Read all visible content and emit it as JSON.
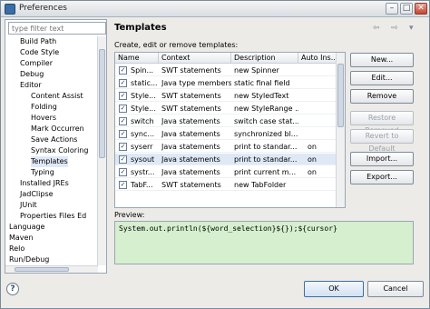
{
  "window": {
    "title": "Preferences"
  },
  "filter": {
    "placeholder": "type filter text"
  },
  "tree": {
    "items": [
      {
        "label": "Build Path",
        "indent": 1
      },
      {
        "label": "Code Style",
        "indent": 1
      },
      {
        "label": "Compiler",
        "indent": 1
      },
      {
        "label": "Debug",
        "indent": 1
      },
      {
        "label": "Editor",
        "indent": 1
      },
      {
        "label": "Content Assist",
        "indent": 2
      },
      {
        "label": "Folding",
        "indent": 2
      },
      {
        "label": "Hovers",
        "indent": 2
      },
      {
        "label": "Mark Occurren",
        "indent": 2
      },
      {
        "label": "Save Actions",
        "indent": 2
      },
      {
        "label": "Syntax Coloring",
        "indent": 2
      },
      {
        "label": "Templates",
        "indent": 2
      },
      {
        "label": "Typing",
        "indent": 2
      },
      {
        "label": "Installed JREs",
        "indent": 1
      },
      {
        "label": "JadClipse",
        "indent": 1
      },
      {
        "label": "JUnit",
        "indent": 1
      },
      {
        "label": "Properties Files Ed",
        "indent": 1
      },
      {
        "label": "Language",
        "indent": 0
      },
      {
        "label": "Maven",
        "indent": 0
      },
      {
        "label": "Relo",
        "indent": 0
      },
      {
        "label": "Run/Debug",
        "indent": 0
      }
    ]
  },
  "page": {
    "title": "Templates",
    "description": "Create, edit or remove templates:",
    "back_arrow": "⇦",
    "forward_arrow": "⇨",
    "menu_arrow": "▾"
  },
  "table": {
    "headers": [
      "Name",
      "Context",
      "Description",
      "Auto Ins..."
    ],
    "rows": [
      {
        "name": "Spin...",
        "context": "SWT statements",
        "description": "new Spinner",
        "auto": ""
      },
      {
        "name": "static...",
        "context": "Java type members",
        "description": "static final field",
        "auto": ""
      },
      {
        "name": "Style...",
        "context": "SWT statements",
        "description": "new StyledText",
        "auto": ""
      },
      {
        "name": "Style...",
        "context": "SWT statements",
        "description": "new StyleRange ...",
        "auto": ""
      },
      {
        "name": "switch",
        "context": "Java statements",
        "description": "switch case stat...",
        "auto": ""
      },
      {
        "name": "sync...",
        "context": "Java statements",
        "description": "synchronized bl...",
        "auto": ""
      },
      {
        "name": "syserr",
        "context": "Java statements",
        "description": "print to standar...",
        "auto": "on"
      },
      {
        "name": "sysout",
        "context": "Java statements",
        "description": "print to standar...",
        "auto": "on",
        "selected": true
      },
      {
        "name": "systr...",
        "context": "Java statements",
        "description": "print current m...",
        "auto": "on"
      },
      {
        "name": "TabF...",
        "context": "SWT statements",
        "description": "new TabFolder",
        "auto": ""
      }
    ]
  },
  "buttons": {
    "new": "New...",
    "edit": "Edit...",
    "remove": "Remove",
    "restore_removed": "Restore Removed",
    "revert": "Revert to Default",
    "import": "Import...",
    "export": "Export..."
  },
  "preview": {
    "label": "Preview:",
    "text": "System.out.println(${word_selection}${});${cursor}"
  },
  "footer": {
    "ok": "OK",
    "cancel": "Cancel",
    "help": "?"
  },
  "colors": {
    "preview_bg": "#d6efcf",
    "selection": "#dfe9f6"
  }
}
